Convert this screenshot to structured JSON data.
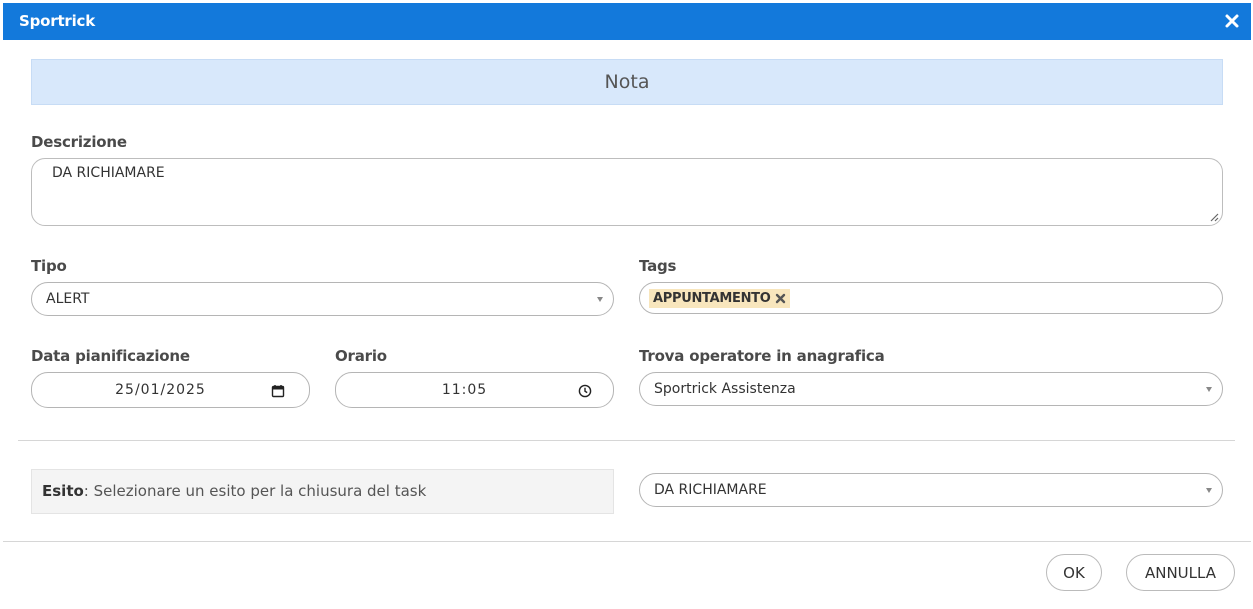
{
  "window": {
    "title": "Sportrick",
    "close_icon": "close-icon"
  },
  "section_title": "Nota",
  "descrizione": {
    "label": "Descrizione",
    "value": "DA RICHIAMARE"
  },
  "tipo": {
    "label": "Tipo",
    "value": "ALERT"
  },
  "tags": {
    "label": "Tags",
    "items": [
      {
        "label": "APPUNTAMENTO"
      }
    ]
  },
  "data_pianificazione": {
    "label": "Data pianificazione",
    "value": "25/01/2025",
    "icon": "calendar-icon"
  },
  "orario": {
    "label": "Orario",
    "value": "11:05",
    "icon": "clock-icon"
  },
  "operatore": {
    "label": "Trova operatore in anagrafica",
    "value": "Sportrick Assistenza"
  },
  "esito": {
    "label": "Esito",
    "text": ": Selezionare un esito per la chiusura del task",
    "value": "DA RICHIAMARE"
  },
  "buttons": {
    "ok": "OK",
    "annulla": "ANNULLA"
  },
  "colors": {
    "titlebar": "#1379db",
    "banner": "#d8e8fb",
    "tag": "#f8e6bd"
  }
}
